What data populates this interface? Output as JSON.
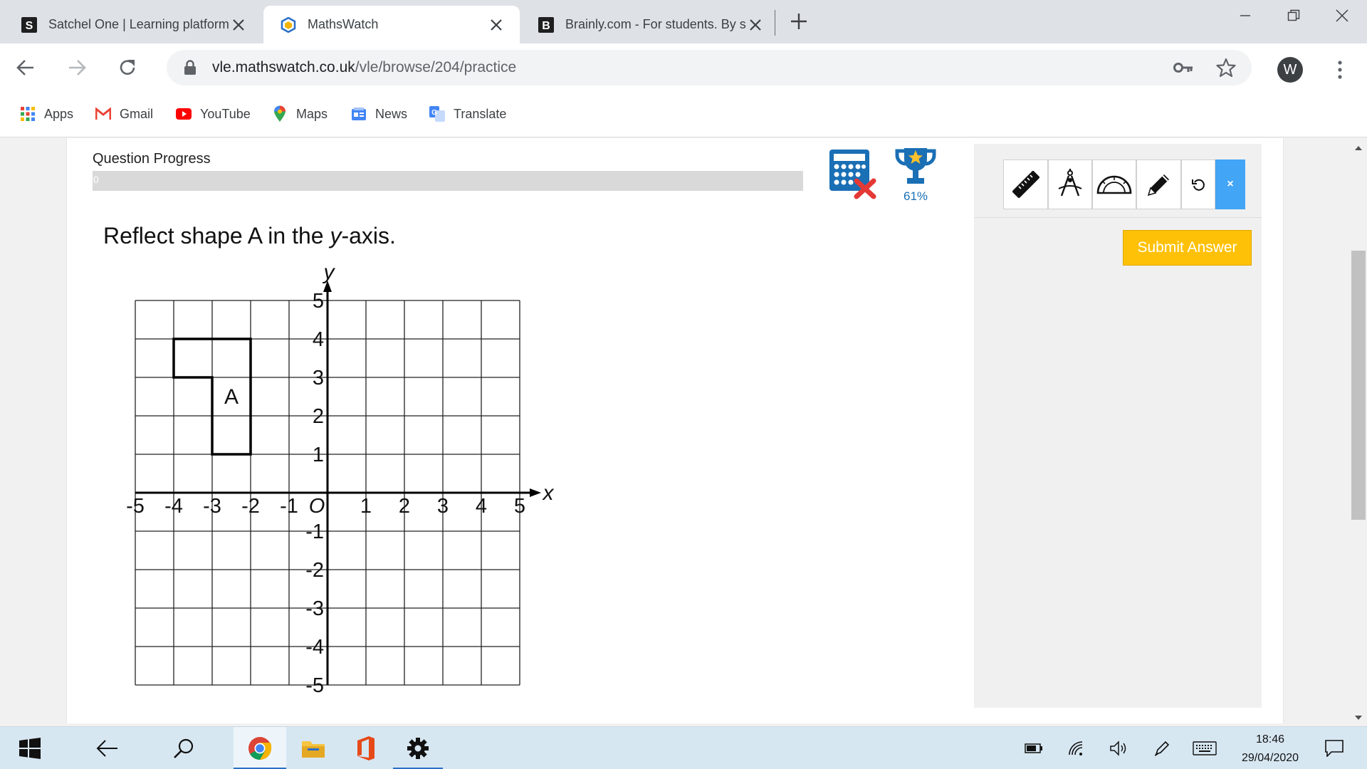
{
  "browser": {
    "tabs": [
      {
        "title": "Satchel One | Learning platform",
        "favicon_letter": "S",
        "favicon": "satchel-icon"
      },
      {
        "title": "MathsWatch",
        "favicon": "mathswatch-icon",
        "active": true
      },
      {
        "title": "Brainly.com - For students. By students",
        "favicon_letter": "B",
        "favicon": "brainly-icon"
      }
    ],
    "url_host": "vle.mathswatch.co.uk",
    "url_path": "/vle/browse/204/practice",
    "profile_initial": "W",
    "bookmarks": [
      {
        "label": "Apps",
        "icon": "apps-grid-icon"
      },
      {
        "label": "Gmail",
        "icon": "gmail-icon"
      },
      {
        "label": "YouTube",
        "icon": "youtube-icon"
      },
      {
        "label": "Maps",
        "icon": "maps-icon"
      },
      {
        "label": "News",
        "icon": "news-icon"
      },
      {
        "label": "Translate",
        "icon": "translate-icon"
      }
    ]
  },
  "page": {
    "progress_label": "Question Progress",
    "progress_value": "0",
    "calculator": {
      "icon": "calculator-not-allowed-icon"
    },
    "trophy": {
      "icon": "trophy-icon",
      "percent": "61%"
    },
    "question": {
      "text_before": "Reflect shape A in the ",
      "variable": "y",
      "text_after": "-axis."
    },
    "graph": {
      "x_label": "x",
      "y_label": "y",
      "origin_label": "O",
      "x_ticks": [
        "-5",
        "-4",
        "-3",
        "-2",
        "-1",
        "1",
        "2",
        "3",
        "4",
        "5"
      ],
      "y_ticks": [
        "5",
        "4",
        "3",
        "2",
        "1",
        "-1",
        "-2",
        "-3",
        "-4",
        "-5"
      ],
      "shape_label": "A",
      "shape_vertices": [
        [
          -4,
          4
        ],
        [
          -2,
          4
        ],
        [
          -2,
          1
        ],
        [
          -3,
          1
        ],
        [
          -3,
          3
        ],
        [
          -4,
          3
        ]
      ],
      "xlim": [
        -5,
        5
      ],
      "ylim": [
        -5,
        5
      ]
    },
    "tools": [
      {
        "name": "ruler",
        "icon": "ruler-icon"
      },
      {
        "name": "compass",
        "icon": "compass-icon"
      },
      {
        "name": "protractor",
        "icon": "protractor-icon"
      },
      {
        "name": "pencil",
        "icon": "pencil-icon"
      },
      {
        "name": "undo",
        "icon": "undo-icon"
      },
      {
        "name": "close",
        "label": "×"
      }
    ],
    "submit_label": "Submit Answer"
  },
  "taskbar": {
    "apps": [
      "windows-start-icon",
      "back-arrow-icon",
      "search-icon",
      "chrome-icon",
      "file-explorer-icon",
      "office-icon",
      "settings-icon"
    ],
    "time": "18:46",
    "date": "29/04/2020"
  }
}
